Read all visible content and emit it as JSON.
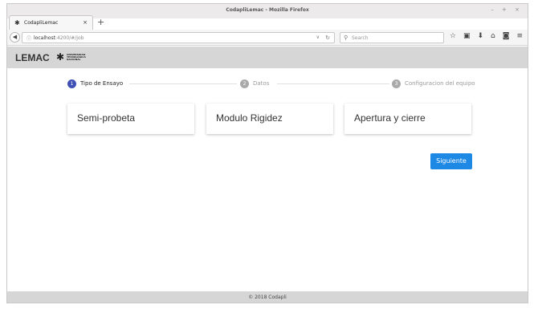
{
  "browser": {
    "window_title": "CodapliLemac - Mozilla Firefox",
    "window_controls": "– + ×",
    "tab": {
      "label": "CodapliLemac",
      "close": "×"
    },
    "new_tab": "+",
    "url": {
      "host": "localhost",
      "rest": ":4200/#/job"
    },
    "search_placeholder": "Search"
  },
  "header": {
    "brand": "LEMAC",
    "logo_text": "UNIVERSIDAD TECNOLÓGICA NACIONAL"
  },
  "stepper": {
    "steps": [
      {
        "number": "1",
        "label": "Tipo de Ensayo",
        "state": "active"
      },
      {
        "number": "2",
        "label": "Datos",
        "state": "inactive"
      },
      {
        "number": "3",
        "label": "Configuracion del equipo",
        "state": "inactive"
      }
    ]
  },
  "cards": [
    {
      "label": "Semi-probeta"
    },
    {
      "label": "Modulo Rigidez"
    },
    {
      "label": "Apertura y cierre"
    }
  ],
  "next_label": "Siguiente",
  "footer": {
    "text": "© 2018 Codapli"
  },
  "colors": {
    "step_active": "#3f51b5",
    "step_inactive": "#a9a9a9",
    "primary_button": "#1e88e5",
    "header_bg": "#d6d6d6"
  }
}
